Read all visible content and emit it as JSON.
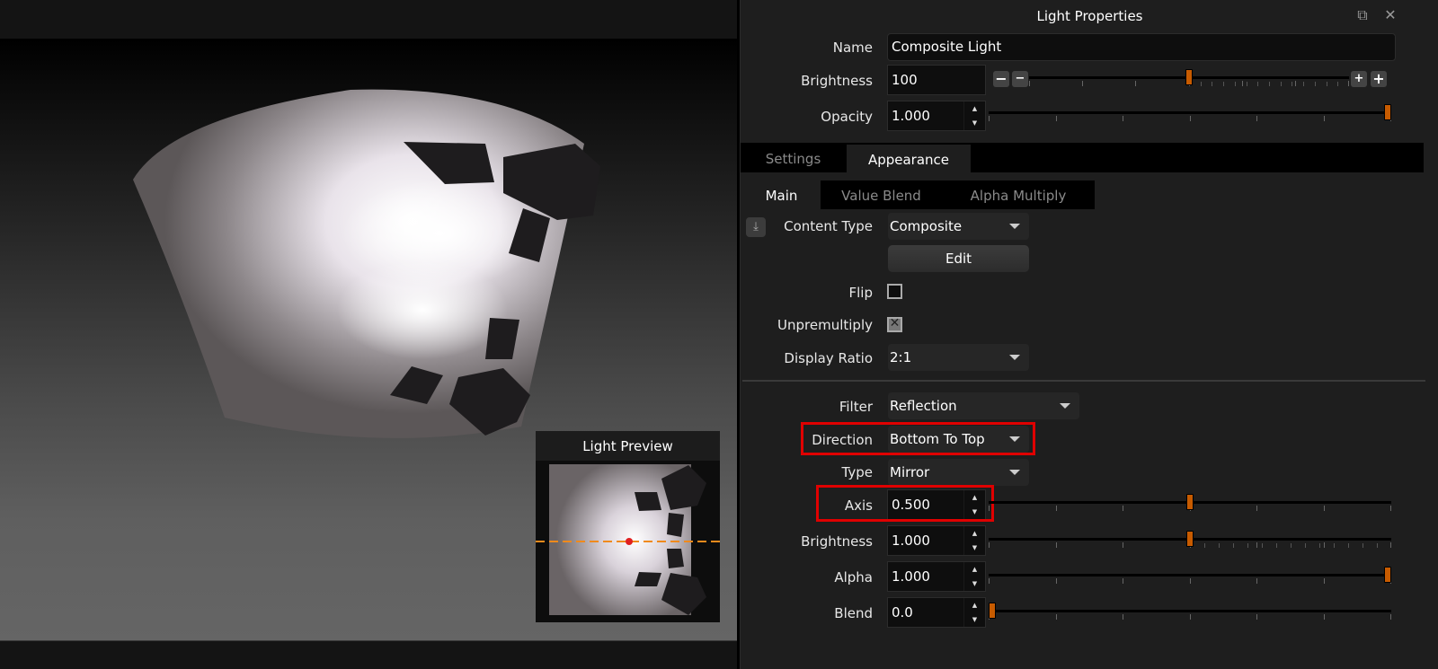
{
  "viewport": {
    "preview": {
      "title": "Light Preview"
    }
  },
  "panel": {
    "title": "Light Properties",
    "title_icons": [
      "restore-window-icon",
      "close-icon"
    ],
    "name": {
      "label": "Name",
      "value": "Composite Light"
    },
    "brightness": {
      "label": "Brightness",
      "value": "100",
      "slider_fraction": 0.5
    },
    "opacity": {
      "label": "Opacity",
      "value": "1.000",
      "slider_fraction": 1.0
    },
    "tabs": [
      {
        "label": "Settings",
        "active": false
      },
      {
        "label": "Appearance",
        "active": true
      }
    ],
    "subtabs": [
      {
        "label": "Main",
        "active": true
      },
      {
        "label": "Value Blend",
        "active": false
      },
      {
        "label": "Alpha Multiply",
        "active": false
      }
    ],
    "content_type": {
      "label": "Content Type",
      "value": "Composite"
    },
    "edit_button": "Edit",
    "flip": {
      "label": "Flip",
      "checked": false
    },
    "unpremultiply": {
      "label": "Unpremultiply",
      "checked": true
    },
    "display_ratio": {
      "label": "Display Ratio",
      "value": "2:1"
    },
    "filter": {
      "label": "Filter",
      "value": "Reflection"
    },
    "direction": {
      "label": "Direction",
      "value": "Bottom To Top",
      "highlighted": true
    },
    "type": {
      "label": "Type",
      "value": "Mirror"
    },
    "axis": {
      "label": "Axis",
      "value": "0.500",
      "slider_fraction": 0.5,
      "highlighted": true
    },
    "brightness2": {
      "label": "Brightness",
      "value": "1.000",
      "slider_fraction": 0.5
    },
    "alpha": {
      "label": "Alpha",
      "value": "1.000",
      "slider_fraction": 1.0
    },
    "blend": {
      "label": "Blend",
      "value": "0.0",
      "slider_fraction": 0.0
    },
    "accent_color": "#c75b00",
    "highlight_color": "#e00000"
  }
}
